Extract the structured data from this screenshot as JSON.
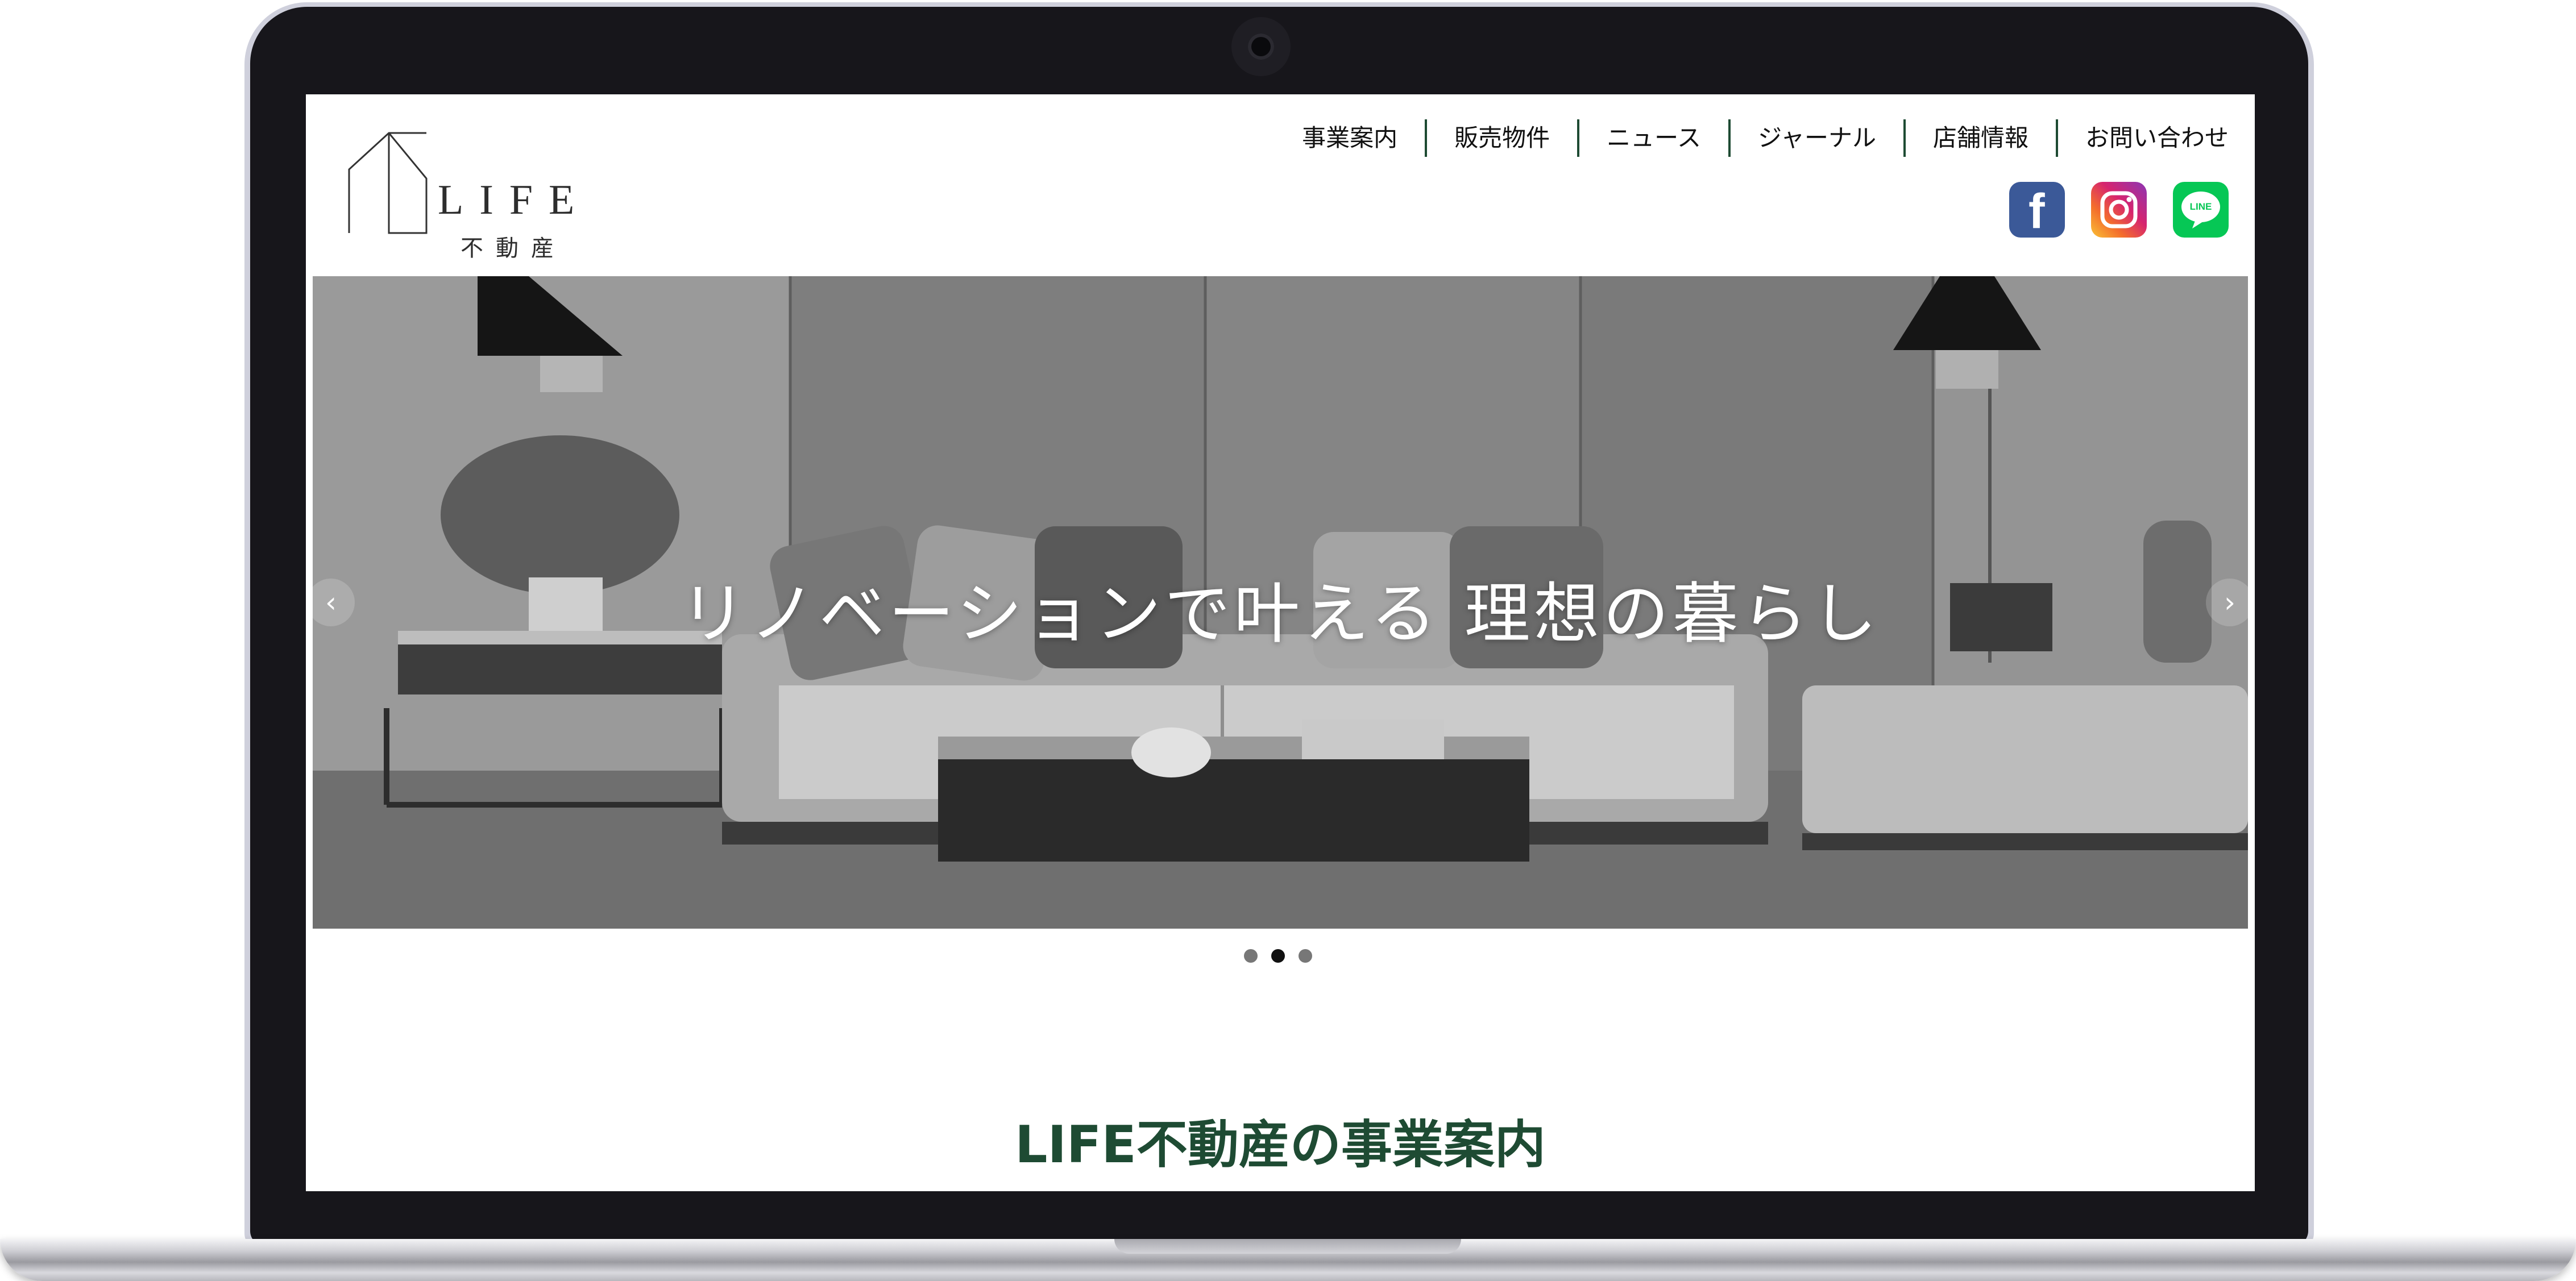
{
  "logo": {
    "wordmark": "LIFE",
    "subtitle": "不動産"
  },
  "nav": {
    "items": [
      "事業案内",
      "販売物件",
      "ニュース",
      "ジャーナル",
      "店舗情報",
      "お問い合わせ"
    ]
  },
  "social": {
    "facebook": {
      "glyph": "f",
      "icon": "facebook-icon",
      "color": "#3b5998"
    },
    "instagram": {
      "icon": "instagram-icon"
    },
    "line": {
      "glyph": "LINE",
      "icon": "line-icon",
      "color": "#06c755"
    }
  },
  "hero": {
    "caption": "リノベーションで叶える 理想の暮らし",
    "prev_glyph": "‹",
    "next_glyph": "›",
    "slide_count": 3,
    "active_slide": 2
  },
  "section": {
    "title": "LIFE不動産の事業案内"
  },
  "colors": {
    "accent": "#1e4b33",
    "bezel": "#17161b"
  }
}
